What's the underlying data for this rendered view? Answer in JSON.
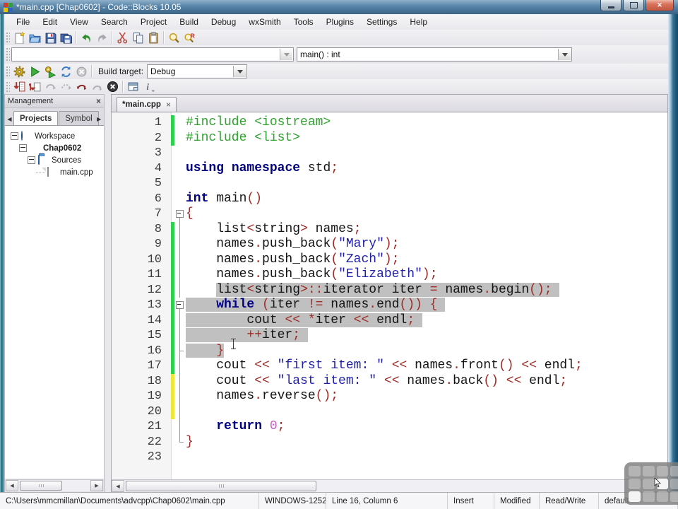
{
  "window": {
    "title": "*main.cpp [Chap0602] - Code::Blocks 10.05",
    "caption_buttons": [
      "minimize",
      "maximize",
      "close"
    ]
  },
  "menu": {
    "items": [
      "File",
      "Edit",
      "View",
      "Search",
      "Project",
      "Build",
      "Debug",
      "wxSmith",
      "Tools",
      "Plugins",
      "Settings",
      "Help"
    ]
  },
  "toolbars": {
    "main_icons": [
      "new-file-icon",
      "open-file-icon",
      "save-icon",
      "save-all-icon",
      "|",
      "undo-icon",
      "redo-icon",
      "|",
      "cut-icon",
      "copy-icon",
      "paste-icon",
      "|",
      "find-icon",
      "replace-icon"
    ],
    "scope_combo": {
      "value": ""
    },
    "symbol_combo": {
      "value": "main() : int"
    },
    "compiler_icons": [
      "build-icon",
      "run-icon",
      "build-and-run-icon",
      "rebuild-icon",
      "abort-icon"
    ],
    "build_target": {
      "label": "Build target:",
      "value": "Debug"
    },
    "debugger_icons": [
      "debug-continue-icon",
      "run-to-cursor-icon",
      "next-line-icon",
      "next-instruction-icon",
      "step-into-icon",
      "step-out-icon",
      "stop-debugger-icon",
      "|",
      "debugging-windows-icon",
      "various-info-icon"
    ]
  },
  "management": {
    "title": "Management",
    "tabs": [
      "Projects",
      "Symbol"
    ],
    "active_tab": "Projects",
    "tree": [
      {
        "label": "Workspace",
        "icon": "workspace-icon",
        "indent": 0,
        "bold": false,
        "expandable": true
      },
      {
        "label": "Chap0602",
        "icon": "project-icon",
        "indent": 1,
        "bold": true,
        "expandable": true
      },
      {
        "label": "Sources",
        "icon": "folder-icon",
        "indent": 2,
        "bold": false,
        "expandable": true
      },
      {
        "label": "main.cpp",
        "icon": "file-icon",
        "indent": 3,
        "bold": false,
        "expandable": false
      }
    ]
  },
  "editor": {
    "tab": {
      "label": "*main.cpp",
      "close": "×"
    },
    "selection_note": "lines 12-16 selected, cursor Line 16 Column 6",
    "code_lines": [
      {
        "n": 1,
        "bar": "green",
        "fold": null,
        "tokens": [
          [
            "pp",
            "#include <iostream>"
          ]
        ]
      },
      {
        "n": 2,
        "bar": "green",
        "fold": null,
        "tokens": [
          [
            "pp",
            "#include <list>"
          ]
        ]
      },
      {
        "n": 3,
        "bar": null,
        "fold": null,
        "tokens": []
      },
      {
        "n": 4,
        "bar": null,
        "fold": null,
        "tokens": [
          [
            "kw",
            "using"
          ],
          [
            "id",
            " "
          ],
          [
            "kw",
            "namespace"
          ],
          [
            "id",
            " std"
          ],
          [
            "op",
            ";"
          ]
        ]
      },
      {
        "n": 5,
        "bar": null,
        "fold": null,
        "tokens": []
      },
      {
        "n": 6,
        "bar": null,
        "fold": null,
        "tokens": [
          [
            "kw",
            "int"
          ],
          [
            "id",
            " main"
          ],
          [
            "op",
            "()"
          ]
        ]
      },
      {
        "n": 7,
        "bar": null,
        "fold": "box",
        "tokens": [
          [
            "op",
            "{"
          ]
        ]
      },
      {
        "n": 8,
        "bar": "green",
        "fold": "line",
        "tokens": [
          [
            "id",
            "    list"
          ],
          [
            "op",
            "<"
          ],
          [
            "id",
            "string"
          ],
          [
            "op",
            ">"
          ],
          [
            "id",
            " names"
          ],
          [
            "op",
            ";"
          ]
        ]
      },
      {
        "n": 9,
        "bar": "green",
        "fold": "line",
        "tokens": [
          [
            "id",
            "    names"
          ],
          [
            "op",
            "."
          ],
          [
            "id",
            "push_back"
          ],
          [
            "op",
            "("
          ],
          [
            "str",
            "\"Mary\""
          ],
          [
            "op",
            ");"
          ]
        ]
      },
      {
        "n": 10,
        "bar": "green",
        "fold": "line",
        "tokens": [
          [
            "id",
            "    names"
          ],
          [
            "op",
            "."
          ],
          [
            "id",
            "push_back"
          ],
          [
            "op",
            "("
          ],
          [
            "str",
            "\"Zach\""
          ],
          [
            "op",
            ");"
          ]
        ]
      },
      {
        "n": 11,
        "bar": "green",
        "fold": "line",
        "tokens": [
          [
            "id",
            "    names"
          ],
          [
            "op",
            "."
          ],
          [
            "id",
            "push_back"
          ],
          [
            "op",
            "("
          ],
          [
            "str",
            "\"Elizabeth\""
          ],
          [
            "op",
            ");"
          ]
        ]
      },
      {
        "n": 12,
        "bar": "green",
        "fold": "line",
        "sel": {
          "from": 4
        },
        "selTrail": true,
        "tokens": [
          [
            "id",
            "    "
          ],
          [
            "id",
            "list"
          ],
          [
            "op",
            "<"
          ],
          [
            "id",
            "string"
          ],
          [
            "op",
            ">::"
          ],
          [
            "id",
            "iterator iter "
          ],
          [
            "op",
            "="
          ],
          [
            "id",
            " names"
          ],
          [
            "op",
            "."
          ],
          [
            "id",
            "begin"
          ],
          [
            "op",
            "();"
          ]
        ]
      },
      {
        "n": 13,
        "bar": "green",
        "fold": "box",
        "sel": {
          "from": 0
        },
        "selTrail": true,
        "tokens": [
          [
            "id",
            "    "
          ],
          [
            "kw",
            "while"
          ],
          [
            "id",
            " "
          ],
          [
            "op",
            "("
          ],
          [
            "id",
            "iter "
          ],
          [
            "op",
            "!="
          ],
          [
            "id",
            " names"
          ],
          [
            "op",
            "."
          ],
          [
            "id",
            "end"
          ],
          [
            "op",
            "())"
          ],
          [
            "id",
            " "
          ],
          [
            "op",
            "{"
          ]
        ]
      },
      {
        "n": 14,
        "bar": "green",
        "fold": "line",
        "sel": {
          "from": 0
        },
        "selTrail": true,
        "tokens": [
          [
            "id",
            "        cout "
          ],
          [
            "op",
            "<<"
          ],
          [
            "id",
            " "
          ],
          [
            "op",
            "*"
          ],
          [
            "id",
            "iter "
          ],
          [
            "op",
            "<<"
          ],
          [
            "id",
            " endl"
          ],
          [
            "op",
            ";"
          ]
        ]
      },
      {
        "n": 15,
        "bar": "green",
        "fold": "line",
        "sel": {
          "from": 0
        },
        "selTrail": true,
        "tokens": [
          [
            "id",
            "        "
          ],
          [
            "op",
            "++"
          ],
          [
            "id",
            "iter"
          ],
          [
            "op",
            ";"
          ]
        ]
      },
      {
        "n": 16,
        "bar": "green",
        "fold": "tee",
        "sel": {
          "from": 0,
          "to": 5
        },
        "tokens": [
          [
            "id",
            "    "
          ],
          [
            "op",
            "}"
          ]
        ]
      },
      {
        "n": 17,
        "bar": "green",
        "fold": "line",
        "tokens": [
          [
            "id",
            "    cout "
          ],
          [
            "op",
            "<<"
          ],
          [
            "id",
            " "
          ],
          [
            "str",
            "\"first item: \""
          ],
          [
            "id",
            " "
          ],
          [
            "op",
            "<<"
          ],
          [
            "id",
            " names"
          ],
          [
            "op",
            "."
          ],
          [
            "id",
            "front"
          ],
          [
            "op",
            "()"
          ],
          [
            "id",
            " "
          ],
          [
            "op",
            "<<"
          ],
          [
            "id",
            " endl"
          ],
          [
            "op",
            ";"
          ]
        ]
      },
      {
        "n": 18,
        "bar": "yellow",
        "fold": "line",
        "tokens": [
          [
            "id",
            "    cout "
          ],
          [
            "op",
            "<<"
          ],
          [
            "id",
            " "
          ],
          [
            "str",
            "\"last item: \""
          ],
          [
            "id",
            " "
          ],
          [
            "op",
            "<<"
          ],
          [
            "id",
            " names"
          ],
          [
            "op",
            "."
          ],
          [
            "id",
            "back"
          ],
          [
            "op",
            "()"
          ],
          [
            "id",
            " "
          ],
          [
            "op",
            "<<"
          ],
          [
            "id",
            " endl"
          ],
          [
            "op",
            ";"
          ]
        ]
      },
      {
        "n": 19,
        "bar": "yellow",
        "fold": "line",
        "tokens": [
          [
            "id",
            "    names"
          ],
          [
            "op",
            "."
          ],
          [
            "id",
            "reverse"
          ],
          [
            "op",
            "();"
          ]
        ]
      },
      {
        "n": 20,
        "bar": "yellow",
        "fold": "line",
        "tokens": []
      },
      {
        "n": 21,
        "bar": null,
        "fold": "line",
        "tokens": [
          [
            "id",
            "    "
          ],
          [
            "kw",
            "return"
          ],
          [
            "id",
            " "
          ],
          [
            "num",
            "0"
          ],
          [
            "op",
            ";"
          ]
        ]
      },
      {
        "n": 22,
        "bar": null,
        "fold": "end",
        "tokens": [
          [
            "op",
            "}"
          ]
        ]
      },
      {
        "n": 23,
        "bar": null,
        "fold": null,
        "tokens": []
      }
    ]
  },
  "status_bar": {
    "cells": [
      "C:\\Users\\mmcmillan\\Documents\\advcpp\\Chap0602\\main.cpp",
      "WINDOWS-1252",
      "Line 16, Column 6",
      "Insert",
      "Modified",
      "Read/Write",
      "default"
    ]
  },
  "colors": {
    "titlebar": "#5684a8",
    "selection": "#c0c0c0",
    "change_bar_saved": "#2ed14e",
    "change_bar_unsaved": "#ede73a",
    "preprocessor": "#2da32d",
    "keyword": "#000080",
    "string": "#2121a8",
    "operator": "#9e2b25",
    "number": "#c75fc7"
  }
}
